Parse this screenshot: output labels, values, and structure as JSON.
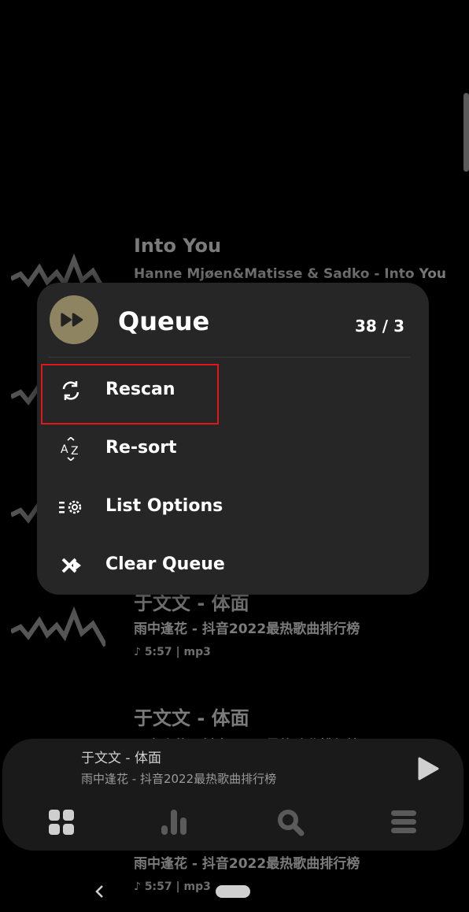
{
  "tracks": [
    {
      "title": "Into You",
      "subtitle": "Hanne Mjøen&Matisse & Sadko - Into You",
      "meta": ""
    },
    {
      "title": "于文文 - 体面",
      "subtitle": "雨中逢花 - 抖音2022最热歌曲排行榜",
      "meta": "5:57 | mp3"
    },
    {
      "title": "于文文 - 体面",
      "subtitle": "雨中逢花 - 抖音2022最热歌曲排行榜",
      "meta": ""
    },
    {
      "title": "",
      "subtitle": "雨中逢花 - 抖音2022最热歌曲排行榜",
      "meta": "5:57 | mp3"
    }
  ],
  "queue_menu": {
    "title": "Queue",
    "count": "38 / 3",
    "icon": "skip-forward-icon",
    "items": [
      {
        "label": "Rescan",
        "icon": "refresh-icon"
      },
      {
        "label": "Re-sort",
        "icon": "sort-az-icon"
      },
      {
        "label": "List Options",
        "icon": "list-options-icon"
      },
      {
        "label": "Clear Queue",
        "icon": "clear-queue-icon"
      }
    ]
  },
  "now_playing": {
    "title": "于文文 - 体面",
    "subtitle": "雨中逢花 - 抖音2022最热歌曲排行榜"
  },
  "bottom_nav": [
    "grid-icon",
    "bar-chart-icon",
    "search-icon",
    "menu-icon"
  ],
  "colors": {
    "background": "#000000",
    "card": "#262626",
    "queue_icon_bg": "#8f8462",
    "highlight": "#e0161b"
  }
}
